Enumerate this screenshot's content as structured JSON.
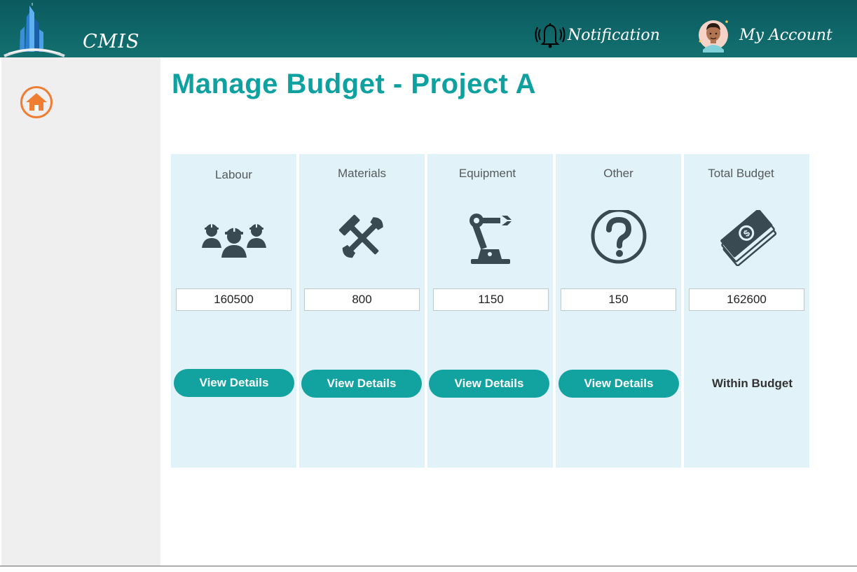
{
  "header": {
    "app_name": "CMIS",
    "notification_label": "Notification",
    "account_label": "My Account"
  },
  "sidebar": {
    "home_icon": "home-icon",
    "accent_color": "#f07e32"
  },
  "main": {
    "title": "Manage Budget - Project A",
    "cards": [
      {
        "label": "Labour",
        "icon": "workers-icon",
        "value": "160500",
        "button_label": "View Details"
      },
      {
        "label": "Materials",
        "icon": "tools-icon",
        "value": "800",
        "button_label": "View Details"
      },
      {
        "label": "Equipment",
        "icon": "robot-arm-icon",
        "value": "1150",
        "button_label": "View Details"
      },
      {
        "label": "Other",
        "icon": "question-icon",
        "value": "150",
        "button_label": "View Details"
      }
    ],
    "total": {
      "label": "Total Budget",
      "icon": "money-icon",
      "value": "162600",
      "status": "Within Budget"
    }
  },
  "colors": {
    "header": "#0f6668",
    "title": "#0fa0a0",
    "button": "#12a2a0",
    "card_bg": "#e1f2f9",
    "sidebar_bg": "#efefef"
  }
}
